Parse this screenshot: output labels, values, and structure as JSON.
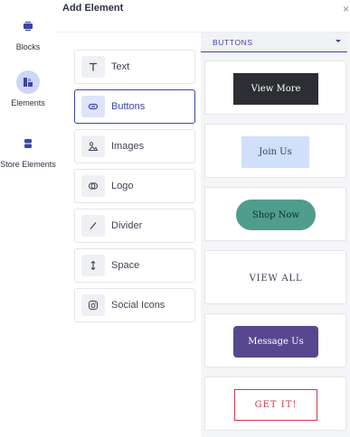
{
  "sidebar": {
    "items": [
      {
        "label": "Blocks",
        "icon": "blocks-icon",
        "active": false
      },
      {
        "label": "Elements",
        "icon": "elements-icon",
        "active": true
      },
      {
        "label": "Store Elements",
        "icon": "store-elements-icon",
        "active": false
      }
    ]
  },
  "panel": {
    "title": "Add Element",
    "close_label": "×"
  },
  "elements": [
    {
      "label": "Text",
      "icon": "text-icon"
    },
    {
      "label": "Buttons",
      "icon": "link-icon",
      "selected": true
    },
    {
      "label": "Images",
      "icon": "image-icon"
    },
    {
      "label": "Logo",
      "icon": "logo-icon"
    },
    {
      "label": "Divider",
      "icon": "divider-icon"
    },
    {
      "label": "Space",
      "icon": "space-icon"
    },
    {
      "label": "Social Icons",
      "icon": "social-icon"
    }
  ],
  "presets": {
    "category_label": "BUTTONS",
    "buttons": [
      {
        "label": "View More"
      },
      {
        "label": "Join Us"
      },
      {
        "label": "Shop Now"
      },
      {
        "label": "VIEW ALL"
      },
      {
        "label": "Message Us"
      },
      {
        "label": "GET IT!"
      }
    ]
  },
  "colors": {
    "accent": "#3b45a6",
    "active_icon_bg": "#cfd6f6",
    "btn_dark": "#2c2e33",
    "btn_light_blue": "#d0e0fb",
    "btn_teal": "#4f9d8d",
    "btn_purple": "#56478f",
    "btn_red_outline": "#d1364d"
  }
}
